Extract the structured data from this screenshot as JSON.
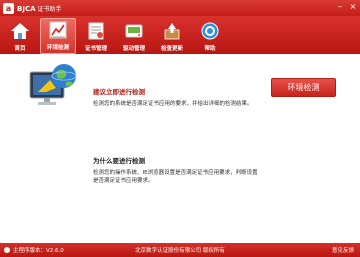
{
  "window": {
    "logo": "a",
    "title": "BJCA",
    "subtitle": "证书助手",
    "minimize_glyph": "–",
    "close_glyph": "×"
  },
  "toolbar": {
    "items": [
      {
        "label": "首页",
        "icon": "home-icon"
      },
      {
        "label": "环境检测",
        "icon": "environment-check-icon",
        "active": true
      },
      {
        "label": "证书管理",
        "icon": "certificate-icon"
      },
      {
        "label": "驱动管理",
        "icon": "driver-icon"
      },
      {
        "label": "检查更新",
        "icon": "update-icon"
      },
      {
        "label": "帮助",
        "icon": "help-icon"
      }
    ]
  },
  "main": {
    "suggest_title": "建议立即进行检测",
    "suggest_desc": "检测您的系统是否满足证书应用的要求，并给出详细的检测结果。",
    "check_button": "环境检测",
    "why_title": "为什么要进行检测",
    "why_desc_line1": "检测您的操作系统、IE浏览器设置是否满足证书应用要求，判断设置",
    "why_desc_line2": "是否满足证书应用要求。"
  },
  "status": {
    "version": "主程序版本：V2.6.0",
    "company": "北京数字认证股份有限公司  版权所有",
    "feedback": "意见反馈"
  },
  "colors": {
    "brand_red": "#c51d18",
    "accent_red": "#b2201b"
  }
}
